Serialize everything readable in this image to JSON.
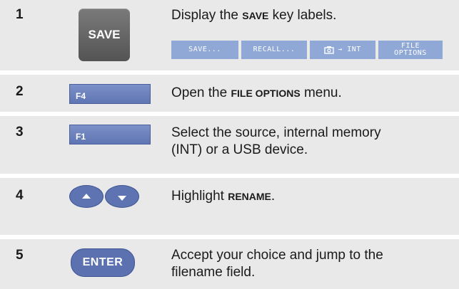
{
  "steps": [
    {
      "number": "1",
      "key_label": "SAVE",
      "desc_before": "Display the ",
      "desc_bold": "SAVE",
      "desc_after": " key labels.",
      "softkeys": [
        "SAVE...",
        "RECALL...",
        "→ INT",
        "FILE OPTIONS"
      ],
      "softkey_icon": "camera-icon"
    },
    {
      "number": "2",
      "key_label": "F4",
      "desc_before": "Open the ",
      "desc_bold": "FILE OPTIONS",
      "desc_after": " menu."
    },
    {
      "number": "3",
      "key_label": "F1",
      "desc_line1": "Select the source, internal memory",
      "desc_line2": "(INT) or a USB device."
    },
    {
      "number": "4",
      "key_icons": [
        "arrow-up-key-icon",
        "arrow-down-key-icon"
      ],
      "desc_before": "Highlight ",
      "desc_bold": "RENAME",
      "desc_after": "."
    },
    {
      "number": "5",
      "key_label": "ENTER",
      "desc_line1": "Accept your choice and jump to the",
      "desc_line2": "filename field."
    }
  ],
  "colors": {
    "row_shading": "#e9e9e9",
    "softkey_bar": "#8fa8d6",
    "function_key": "#5f75b4",
    "save_key": "#5e5e5e"
  }
}
